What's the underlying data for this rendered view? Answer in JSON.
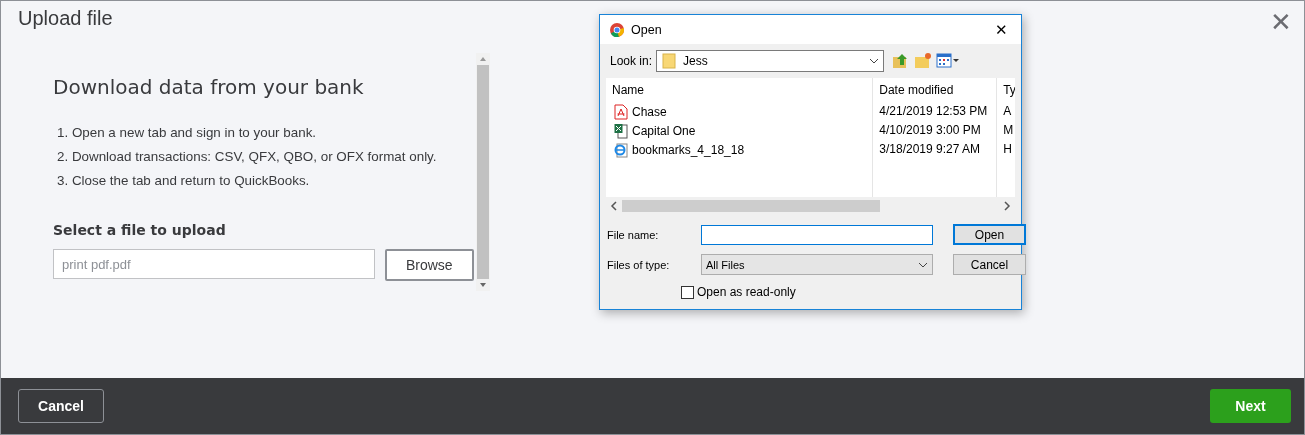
{
  "header": {
    "title": "Upload file",
    "close": "✕"
  },
  "content": {
    "heading": "Download data from your bank",
    "steps": [
      "1. Open a new tab and sign in to your bank.",
      "2. Download transactions: CSV, QFX, QBO, or OFX format only.",
      "3. Close the tab and return to QuickBooks."
    ],
    "select_label": "Select a file to upload",
    "file_field": {
      "placeholder": "print pdf.pdf"
    },
    "browse_button": "Browse"
  },
  "dialog": {
    "title": "Open",
    "close": "✕",
    "look_in_label": "Look in:",
    "look_in_value": "Jess",
    "columns": [
      "Name",
      "Date modified",
      "Ty"
    ],
    "files": [
      {
        "kind": "pdf",
        "name": "Chase",
        "date": "4/21/2019 12:53 PM",
        "type": "A"
      },
      {
        "kind": "excel",
        "name": "Capital One",
        "date": "4/10/2019 3:00 PM",
        "type": "M"
      },
      {
        "kind": "web",
        "name": "bookmarks_4_18_18",
        "date": "3/18/2019 9:27 AM",
        "type": "H"
      }
    ],
    "file_name_label": "File name:",
    "files_of_type_label": "Files of type:",
    "files_of_type_value": "All Files",
    "open_button": "Open",
    "cancel_button": "Cancel",
    "read_only": {
      "label": "Open as read-only",
      "checked": false
    }
  },
  "footer": {
    "cancel": "Cancel",
    "next": "Next"
  }
}
